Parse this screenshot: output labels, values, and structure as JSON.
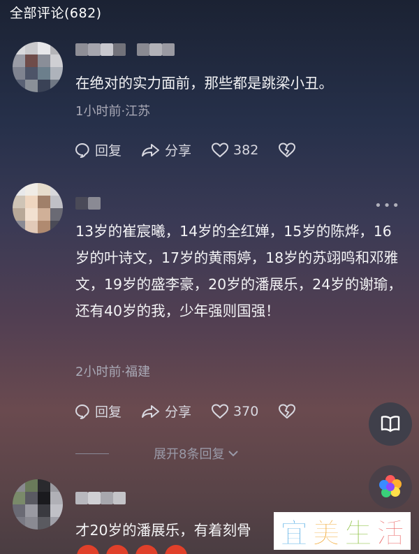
{
  "header": {
    "title": "全部评论(682)"
  },
  "comments": [
    {
      "text": "在绝对的实力面前，那些都是跳梁小丑。",
      "meta": "1小时前·江苏",
      "reply_label": "回复",
      "share_label": "分享",
      "likes": "382"
    },
    {
      "text": "13岁的崔宸曦，14岁的全红婵，15岁的陈烨，16岁的叶诗文，17岁的黄雨婷，18岁的苏翊鸣和邓雅文，19岁的盛李豪，20岁的潘展乐，24岁的谢瑜，还有40岁的我，少年强则国强！",
      "meta": "2小时前·福建",
      "reply_label": "回复",
      "share_label": "分享",
      "likes": "370",
      "expand_label": "展开8条回复"
    },
    {
      "text": "才20岁的潘展乐，有着刻骨"
    }
  ],
  "watermark": {
    "chars": [
      "宜",
      "美",
      "生",
      "活"
    ],
    "colors": [
      "#3aa0e0",
      "#f0a020",
      "#8cc040",
      "#e85050"
    ]
  },
  "colors": {
    "accent_like": "#d8d8e0"
  }
}
